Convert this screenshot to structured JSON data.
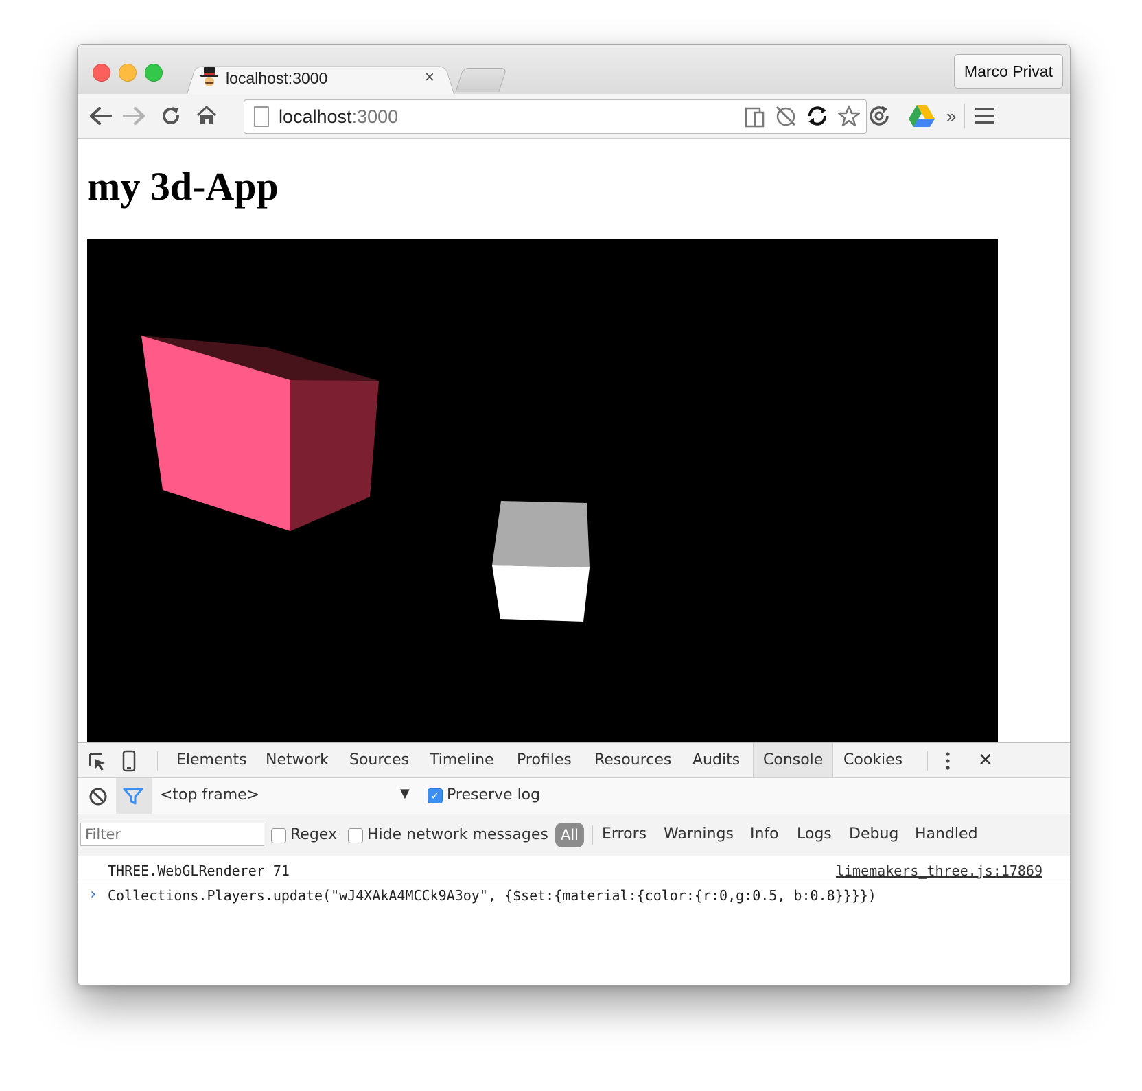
{
  "browser": {
    "tab_title": "localhost:3000",
    "tab_close": "×",
    "profile_name": "Marco Privat",
    "address": {
      "host": "localhost",
      "port": ":3000"
    },
    "extensions_overflow": "»"
  },
  "page": {
    "heading": "my 3d-App"
  },
  "scene": {
    "background": "#000000",
    "objects": [
      {
        "name": "pink-cube",
        "front_color": "#ff5a88",
        "side_color": "#7c1f30",
        "top_color": "#46131b"
      },
      {
        "name": "white-cube",
        "front_color": "#ffffff",
        "top_color": "#ababab"
      }
    ]
  },
  "devtools": {
    "tabs": [
      "Elements",
      "Network",
      "Sources",
      "Timeline",
      "Profiles",
      "Resources",
      "Audits",
      "Console",
      "Cookies"
    ],
    "active_tab": "Console",
    "close": "✕",
    "frame_selector": "<top frame>",
    "preserve_log": {
      "label": "Preserve log",
      "checked": true
    },
    "filter_placeholder": "Filter",
    "regex_label": "Regex",
    "hide_network_label": "Hide network messages",
    "levels": [
      "All",
      "Errors",
      "Warnings",
      "Info",
      "Logs",
      "Debug",
      "Handled"
    ],
    "console": {
      "log_message": "THREE.WebGLRenderer 71",
      "log_source": "limemakers_three.js:17869",
      "prompt_input": "Collections.Players.update(\"wJ4XAkA4MCCk9A3oy\", {$set:{material:{color:{r:0,g:0.5, b:0.8}}}})"
    }
  },
  "colors": {
    "accent_blue": "#3b8ef2",
    "traffic_red": "#fc605c",
    "traffic_yellow": "#fdbc40",
    "traffic_green": "#34c84a"
  }
}
